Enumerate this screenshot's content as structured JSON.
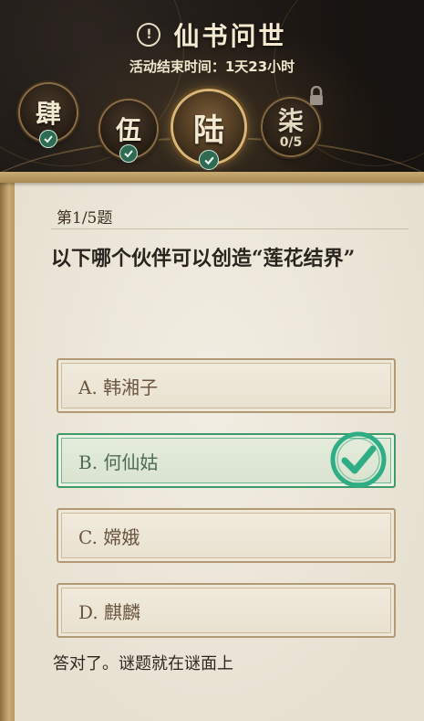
{
  "header": {
    "title": "仙书问世",
    "end_time_text": "活动结束时间：1天23小时",
    "alert_icon": "!"
  },
  "levels": [
    {
      "label": "肆",
      "completed": true
    },
    {
      "label": "伍",
      "completed": true
    },
    {
      "label": "陆",
      "completed": true,
      "active": true
    },
    {
      "label": "柒",
      "locked": true,
      "progress": "0/5"
    }
  ],
  "quiz": {
    "question_number": "第1/5题",
    "question": "以下哪个伙伴可以创造“莲花结界”",
    "options": [
      {
        "label": "A. 韩湘子"
      },
      {
        "label": "B. 何仙姑",
        "correct": true
      },
      {
        "label": "C. 嫦娥"
      },
      {
        "label": "D. 麒麟"
      }
    ],
    "feedback": "答对了。谜题就在谜面上"
  },
  "colors": {
    "accent_gold": "#d8b676",
    "correct_green": "#2fae86",
    "parchment": "#ece6d6"
  }
}
